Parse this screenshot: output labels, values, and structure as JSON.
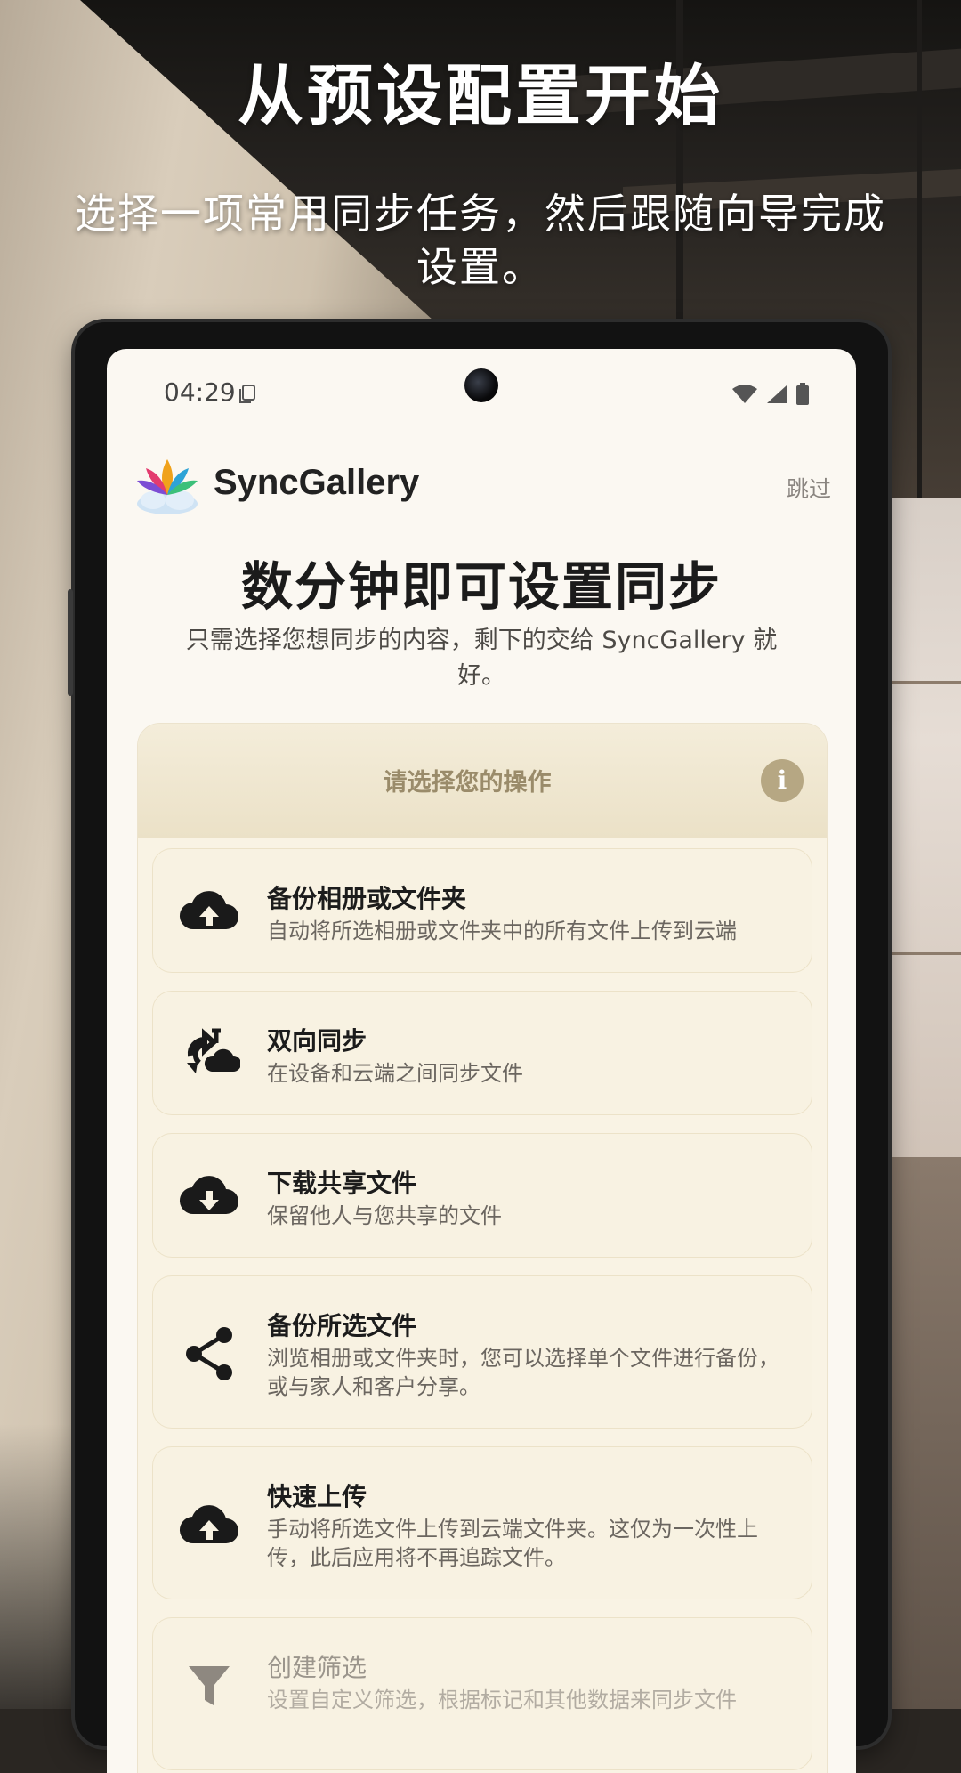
{
  "headline": "从预设配置开始",
  "subhead": "选择一项常用同步任务，然后跟随向导完成设置。",
  "status": {
    "time": "04:29"
  },
  "app": {
    "name": "SyncGallery",
    "skip": "跳过"
  },
  "page": {
    "title": "数分钟即可设置同步",
    "subtitle": "只需选择您想同步的内容，剩下的交给 SyncGallery 就好。"
  },
  "card": {
    "title": "请选择您的操作",
    "info_icon": "i",
    "options": [
      {
        "icon": "cloud-upload-icon",
        "title": "备份相册或文件夹",
        "desc": "自动将所选相册或文件夹中的所有文件上传到云端"
      },
      {
        "icon": "two-way-sync-icon",
        "title": "双向同步",
        "desc": "在设备和云端之间同步文件"
      },
      {
        "icon": "cloud-download-icon",
        "title": "下载共享文件",
        "desc": "保留他人与您共享的文件"
      },
      {
        "icon": "share-icon",
        "title": "备份所选文件",
        "desc": "浏览相册或文件夹时，您可以选择单个文件进行备份，或与家人和客户分享。"
      },
      {
        "icon": "cloud-upload-icon",
        "title": "快速上传",
        "desc": "手动将所选文件上传到云端文件夹。这仅为一次性上传，此后应用将不再追踪文件。"
      },
      {
        "icon": "filter-icon",
        "title": "创建筛选",
        "desc": "设置自定义筛选，根据标记和其他数据来同步文件"
      }
    ]
  }
}
